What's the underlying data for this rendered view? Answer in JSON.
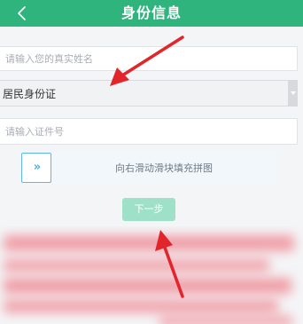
{
  "header": {
    "title": "身份信息",
    "back_icon": "chevron-left-icon",
    "color": "#2fb47e"
  },
  "form": {
    "name_placeholder": "请输入您的真实姓名",
    "id_type_selected": "居民身份证",
    "id_number_placeholder": "请输入证件号"
  },
  "slider": {
    "handle_icon": "double-chevron-right-icon",
    "handle_glyph": "»",
    "text": "向右滑动滑块填充拼图"
  },
  "next_button": {
    "label": "下一步",
    "color": "#9fe0c9"
  },
  "annotations": {
    "arrow_color": "#e1252b"
  }
}
